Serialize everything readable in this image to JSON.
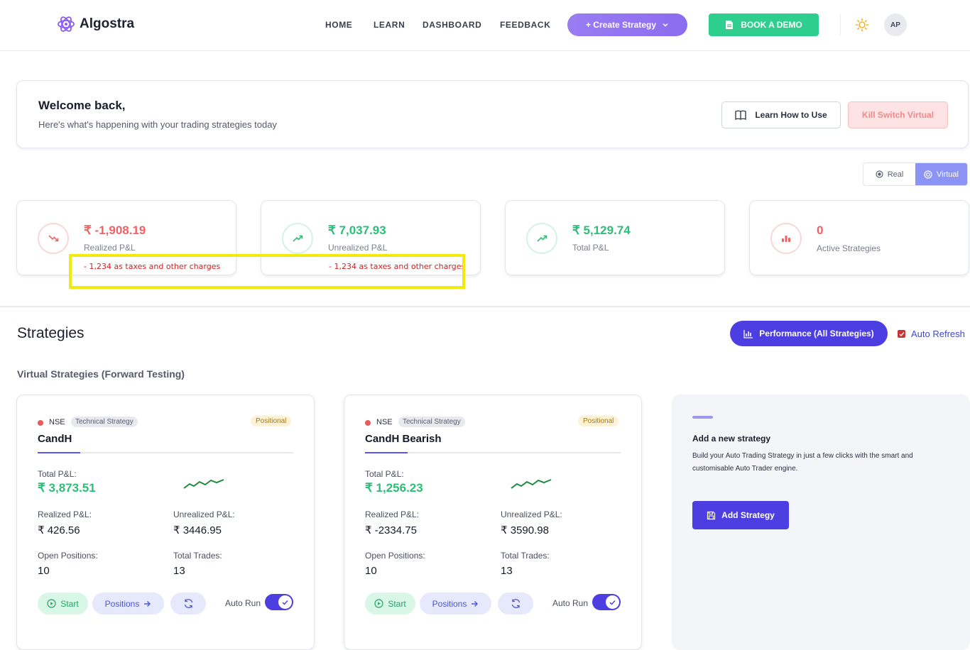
{
  "brand": {
    "name": "Algostra"
  },
  "nav": {
    "items": [
      "HOME",
      "LEARN",
      "DASHBOARD",
      "FEEDBACK"
    ],
    "create_label": "+ Create Strategy",
    "demo_label": "BOOK A DEMO",
    "avatar_initials": "AP"
  },
  "welcome": {
    "title": "Welcome back,",
    "subtitle": "Here's what's happening with your trading strategies today",
    "learn_label": "Learn How to Use",
    "kill_label": "Kill Switch Virtual"
  },
  "mode_toggle": {
    "real_label": "Real",
    "virtual_label": "Virtual",
    "selected": "Virtual"
  },
  "stats": [
    {
      "value": "₹ -1,908.19",
      "label": "Realized P&L",
      "note": "- 1,234 as taxes and other charges",
      "color": "#f06262"
    },
    {
      "value": "₹ 7,037.93",
      "label": "Unrealized P&L",
      "note": "- 1,234 as taxes and other charges",
      "color": "#2cbe78"
    },
    {
      "value": "₹ 5,129.74",
      "label": "Total P&L",
      "color": "#2cbe78"
    },
    {
      "value": "0",
      "label": "Active Strategies",
      "color": "#f06262"
    }
  ],
  "strategies": {
    "title": "Strategies",
    "performance_label": "Performance (All Strategies)",
    "auto_refresh_label": "Auto Refresh",
    "auto_refresh_checked": true,
    "section_label": "Virtual Strategies (Forward Testing)",
    "labels": {
      "total_pnl": "Total P&L:",
      "realized": "Realized P&L:",
      "unrealized": "Unrealized P&L:",
      "open_positions": "Open Positions:",
      "total_trades": "Total Trades:",
      "start": "Start",
      "positions": "Positions",
      "auto_run": "Auto Run"
    },
    "cards": [
      {
        "exchange": "NSE",
        "tag": "Technical Strategy",
        "type": "Positional",
        "name": "CandH",
        "total_pnl": "₹ 3,873.51",
        "realized": "₹ 426.56",
        "unrealized": "₹ 3446.95",
        "open_positions": "10",
        "total_trades": "13",
        "auto_run": true
      },
      {
        "exchange": "NSE",
        "tag": "Technical Strategy",
        "type": "Positional",
        "name": "CandH Bearish",
        "total_pnl": "₹ 1,256.23",
        "realized": "₹ -2334.75",
        "unrealized": "₹ 3590.98",
        "open_positions": "10",
        "total_trades": "13",
        "auto_run": true
      }
    ],
    "add": {
      "title": "Add a new strategy",
      "description": "Build your Auto Trading Strategy in just a few clicks with the smart and customisable Auto Trader engine.",
      "button_label": "Add Strategy"
    }
  },
  "colors": {
    "accent": "#4c3ee0",
    "success": "#2cbe78",
    "danger": "#f06262",
    "demo": "#2ecf8e",
    "highlight": "#f2ea0c"
  }
}
